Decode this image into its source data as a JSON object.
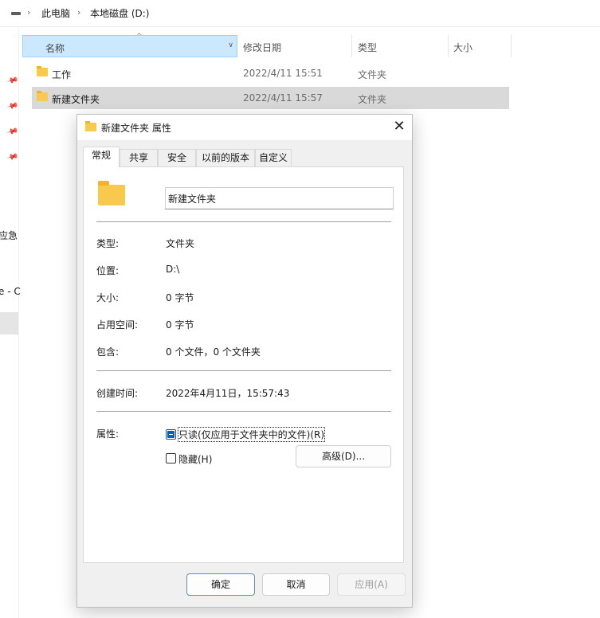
{
  "explorer": {
    "breadcrumb": [
      "此电脑",
      "本地磁盘 (D:)"
    ],
    "left_pane_cut_texts": [
      "应急",
      "e - C"
    ],
    "columns": {
      "name": "名称",
      "date": "修改日期",
      "type": "类型",
      "size": "大小"
    },
    "files": [
      {
        "name": "工作",
        "date": "2022/4/11 15:51",
        "type": "文件夹"
      },
      {
        "name": "新建文件夹",
        "date": "2022/4/11 15:57",
        "type": "文件夹"
      }
    ]
  },
  "dialog": {
    "title": "新建文件夹 属性",
    "close_glyph": "✕",
    "tabs": [
      "常规",
      "共享",
      "安全",
      "以前的版本",
      "自定义"
    ],
    "folder_name": "新建文件夹",
    "properties": {
      "type_label": "类型:",
      "type_value": "文件夹",
      "location_label": "位置:",
      "location_value": "D:\\",
      "size_label": "大小:",
      "size_value": "0 字节",
      "disk_size_label": "占用空间:",
      "disk_size_value": "0 字节",
      "contains_label": "包含:",
      "contains_value": "0 个文件，0 个文件夹",
      "created_label": "创建时间:",
      "created_value": "2022年4月11日，15:57:43"
    },
    "attributes": {
      "label": "属性:",
      "readonly_label": "只读(仅应用于文件夹中的文件)(R)",
      "hidden_label": "隐藏(H)",
      "advanced_button": "高级(D)..."
    },
    "buttons": {
      "ok": "确定",
      "cancel": "取消",
      "apply": "应用(A)"
    }
  }
}
